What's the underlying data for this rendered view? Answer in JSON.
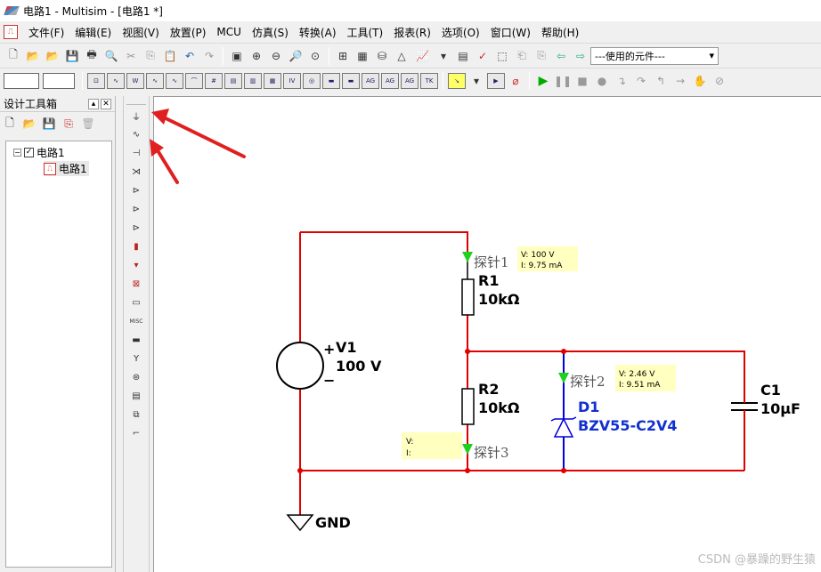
{
  "window": {
    "title": "电路1 - Multisim - [电路1 *]"
  },
  "menu": [
    "文件(F)",
    "编辑(E)",
    "视图(V)",
    "放置(P)",
    "MCU",
    "仿真(S)",
    "转换(A)",
    "工具(T)",
    "报表(R)",
    "选项(O)",
    "窗口(W)",
    "帮助(H)"
  ],
  "toolbar": {
    "component_combo": "---使用的元件---"
  },
  "design_toolbox": {
    "title": "设计工具箱",
    "tree": {
      "root": "电路1",
      "child": "电路1"
    }
  },
  "schematic": {
    "v1": {
      "name": "V1",
      "value": "100 V",
      "plus": "+",
      "minus": "−"
    },
    "r1": {
      "name": "R1",
      "value": "10kΩ"
    },
    "r2": {
      "name": "R2",
      "value": "10kΩ"
    },
    "d1": {
      "name": "D1",
      "value": "BZV55-C2V4"
    },
    "c1": {
      "name": "C1",
      "value": "10μF"
    },
    "gnd": "GND",
    "probes": [
      {
        "name": "探针1",
        "v": "V: 100 V",
        "i": "I: 9.75 mA"
      },
      {
        "name": "探针2",
        "v": "V: 2.46 V",
        "i": "I: 9.51 mA"
      },
      {
        "name": "探针3",
        "v": "V:",
        "i": "I:"
      }
    ]
  },
  "watermark": "CSDN @暴躁的野生猿",
  "colors": {
    "wire": "#e00000",
    "diode_wire": "#0000e0",
    "probe_arrow": "#1fd01f",
    "probe_box": "#ffffc0",
    "annotation_arrow": "#e02020",
    "diode_label": "#1030d0"
  }
}
